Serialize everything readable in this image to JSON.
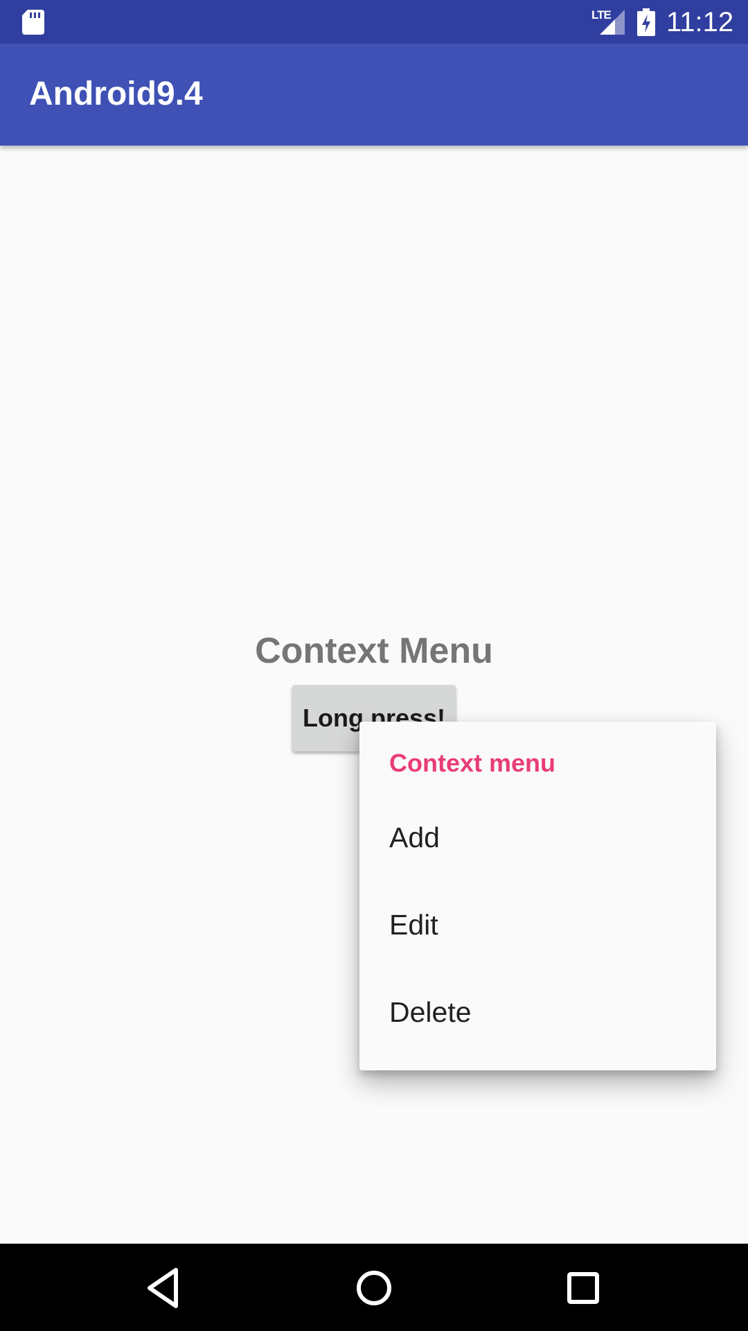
{
  "status_bar": {
    "network_type": "LTE",
    "time": "11:12",
    "icons": [
      "sd-card-icon",
      "signal-icon",
      "battery-charging-icon"
    ],
    "background_color": "#303f9f"
  },
  "app_bar": {
    "title": "Android9.4",
    "background_color": "#3f51b5"
  },
  "main": {
    "heading": "Context Menu",
    "button_label": "Long press!"
  },
  "context_menu": {
    "title": "Context menu",
    "title_color": "#e93c79",
    "items": [
      {
        "label": "Add"
      },
      {
        "label": "Edit"
      },
      {
        "label": "Delete"
      }
    ]
  },
  "nav_bar": {
    "buttons": [
      "back-icon",
      "home-icon",
      "recents-icon"
    ]
  }
}
